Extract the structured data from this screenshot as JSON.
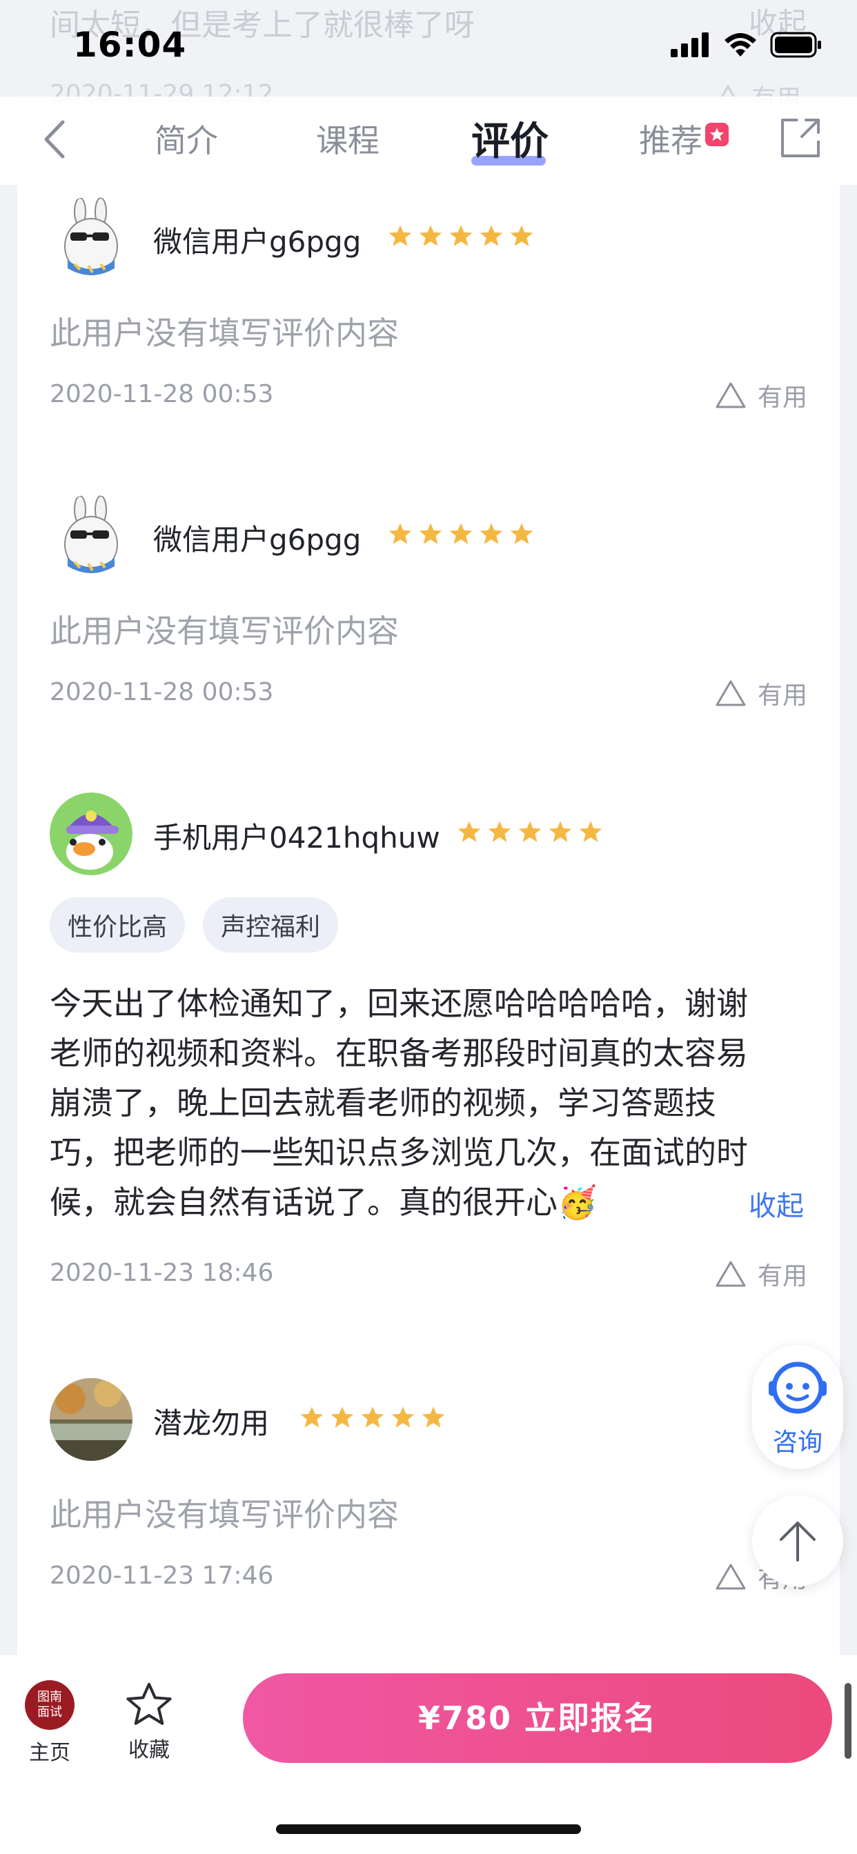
{
  "status_bar": {
    "time": "16:04"
  },
  "ghost_review": {
    "text": "间太短，但是考上了就很棒了呀",
    "fold": "收起",
    "date": "2020-11-29 12:12",
    "useful": "有用"
  },
  "nav": {
    "tabs": [
      {
        "label": "简介"
      },
      {
        "label": "课程"
      },
      {
        "label": "评价"
      },
      {
        "label": "推荐"
      }
    ],
    "active_tab": "评价",
    "back_icon": "chevron-left-icon",
    "share_icon": "share-icon"
  },
  "reviews": [
    {
      "username": "微信用户g6pgg",
      "rating": 5,
      "content": "此用户没有填写评价内容",
      "date": "2020-11-28 00:53",
      "useful": "有用"
    },
    {
      "username": "微信用户g6pgg",
      "rating": 5,
      "content": "此用户没有填写评价内容",
      "date": "2020-11-28 00:53",
      "useful": "有用"
    },
    {
      "username": "手机用户0421hqhuw",
      "rating": 5,
      "tags": [
        "性价比高",
        "声控福利"
      ],
      "content_lines": [
        "今天出了体检通知了，回来还愿哈哈哈哈哈，谢谢",
        "老师的视频和资料。在职备考那段时间真的太容易",
        "崩溃了，晚上回去就看老师的视频，学习答题技",
        "巧，把老师的一些知识点多浏览几次，在面试的时",
        "候，就会自然有话说了。真的很开心🥳"
      ],
      "fold": "收起",
      "date": "2020-11-23 18:46",
      "useful": "有用"
    },
    {
      "username": "潜龙勿用",
      "rating": 5,
      "content": "此用户没有填写评价内容",
      "date": "2020-11-23 17:46",
      "useful": "有用"
    }
  ],
  "floating": {
    "consult_label": "咨询"
  },
  "bottom_bar": {
    "home_logo_line1": "图南",
    "home_logo_line2": "面试",
    "home_label": "主页",
    "fav_label": "收藏",
    "enroll_label": "¥780  立即报名"
  },
  "colors": {
    "accent_blue": "#3e78f0",
    "star": "#f4b842",
    "enroll_gradient_start": "#f058a4",
    "enroll_gradient_end": "#ec4a7c",
    "badge": "#f2446c"
  }
}
